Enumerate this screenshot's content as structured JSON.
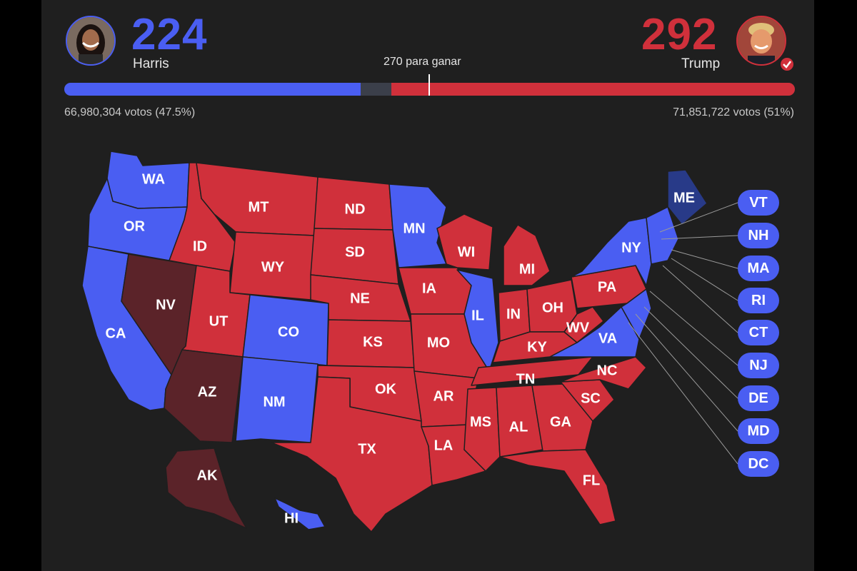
{
  "colors": {
    "harris_blue": "#4a5ef2",
    "trump_red": "#d0303b",
    "battleground_dark": "#5b2329",
    "maine_navy": "#283a88",
    "uncalled_gray": "#3b3f4a",
    "background": "#1f1f1f"
  },
  "harris": {
    "name": "Harris",
    "electoral_votes": "224",
    "popular_votes": "66,980,304 votos (47.5%)",
    "ev_value": 224
  },
  "trump": {
    "name": "Trump",
    "electoral_votes": "292",
    "popular_votes": "71,851,722 votos (51%)",
    "ev_value": 292,
    "winner_badge": "check-icon"
  },
  "threshold_label": "270 para ganar",
  "threshold_value": 270,
  "total_ev": 538,
  "states": [
    {
      "abbr": "WA",
      "winner": "harris"
    },
    {
      "abbr": "OR",
      "winner": "harris"
    },
    {
      "abbr": "CA",
      "winner": "harris"
    },
    {
      "abbr": "NV",
      "winner": "trump-flip"
    },
    {
      "abbr": "ID",
      "winner": "trump"
    },
    {
      "abbr": "MT",
      "winner": "trump"
    },
    {
      "abbr": "WY",
      "winner": "trump"
    },
    {
      "abbr": "UT",
      "winner": "trump"
    },
    {
      "abbr": "AZ",
      "winner": "trump-flip"
    },
    {
      "abbr": "CO",
      "winner": "harris"
    },
    {
      "abbr": "NM",
      "winner": "harris"
    },
    {
      "abbr": "ND",
      "winner": "trump"
    },
    {
      "abbr": "SD",
      "winner": "trump"
    },
    {
      "abbr": "NE",
      "winner": "trump"
    },
    {
      "abbr": "KS",
      "winner": "trump"
    },
    {
      "abbr": "OK",
      "winner": "trump"
    },
    {
      "abbr": "TX",
      "winner": "trump"
    },
    {
      "abbr": "MN",
      "winner": "harris"
    },
    {
      "abbr": "IA",
      "winner": "trump"
    },
    {
      "abbr": "MO",
      "winner": "trump"
    },
    {
      "abbr": "AR",
      "winner": "trump"
    },
    {
      "abbr": "LA",
      "winner": "trump"
    },
    {
      "abbr": "WI",
      "winner": "trump"
    },
    {
      "abbr": "IL",
      "winner": "harris"
    },
    {
      "abbr": "MI",
      "winner": "trump"
    },
    {
      "abbr": "IN",
      "winner": "trump"
    },
    {
      "abbr": "OH",
      "winner": "trump"
    },
    {
      "abbr": "KY",
      "winner": "trump"
    },
    {
      "abbr": "TN",
      "winner": "trump"
    },
    {
      "abbr": "MS",
      "winner": "trump"
    },
    {
      "abbr": "AL",
      "winner": "trump"
    },
    {
      "abbr": "GA",
      "winner": "trump"
    },
    {
      "abbr": "FL",
      "winner": "trump"
    },
    {
      "abbr": "SC",
      "winner": "trump"
    },
    {
      "abbr": "NC",
      "winner": "trump"
    },
    {
      "abbr": "VA",
      "winner": "harris"
    },
    {
      "abbr": "WV",
      "winner": "trump"
    },
    {
      "abbr": "PA",
      "winner": "trump"
    },
    {
      "abbr": "NY",
      "winner": "harris"
    },
    {
      "abbr": "ME",
      "winner": "harris-split"
    },
    {
      "abbr": "AK",
      "winner": "trump-flip"
    },
    {
      "abbr": "HI",
      "winner": "harris"
    }
  ],
  "small_states": [
    "VT",
    "NH",
    "MA",
    "RI",
    "CT",
    "NJ",
    "DE",
    "MD",
    "DC"
  ]
}
